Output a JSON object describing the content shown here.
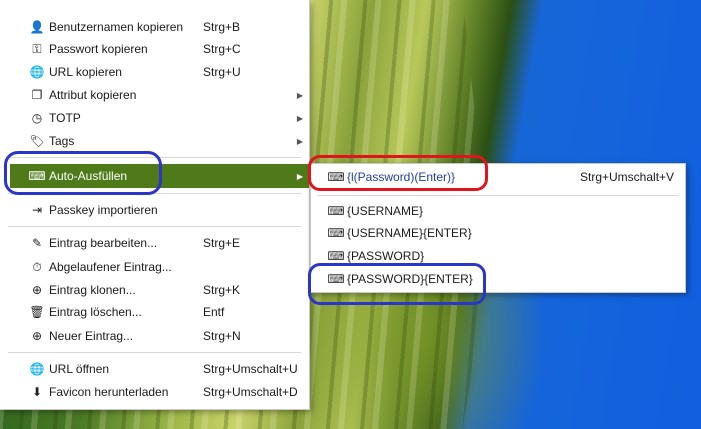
{
  "main_menu": {
    "items": [
      {
        "icon": "user-copy-icon",
        "glyph": "👤",
        "label": "Benutzernamen kopieren",
        "shortcut": "Strg+B"
      },
      {
        "icon": "key-icon",
        "glyph": "⚿",
        "label": "Passwort kopieren",
        "shortcut": "Strg+C"
      },
      {
        "icon": "globe-icon",
        "glyph": "🌐",
        "label": "URL kopieren",
        "shortcut": "Strg+U"
      },
      {
        "icon": "copy-icon",
        "glyph": "❐",
        "label": "Attribut kopieren",
        "submenu": true
      },
      {
        "icon": "clock-icon",
        "glyph": "◷",
        "label": "TOTP",
        "submenu": true
      },
      {
        "icon": "tag-icon",
        "glyph": "🏷",
        "label": "Tags",
        "submenu": true
      },
      {
        "icon": "keyboard-icon",
        "glyph": "⌨",
        "label": "Auto-Ausfüllen",
        "submenu": true,
        "active": true
      },
      {
        "icon": "import-icon",
        "glyph": "⇥",
        "label": "Passkey importieren"
      },
      {
        "icon": "edit-icon",
        "glyph": "✎",
        "label": "Eintrag bearbeiten...",
        "shortcut": "Strg+E"
      },
      {
        "icon": "timer-icon",
        "glyph": "⏱",
        "label": "Abgelaufener Eintrag..."
      },
      {
        "icon": "clone-icon",
        "glyph": "⊕",
        "label": "Eintrag klonen...",
        "shortcut": "Strg+K"
      },
      {
        "icon": "trash-icon",
        "glyph": "🗑",
        "label": "Eintrag löschen...",
        "shortcut": "Entf"
      },
      {
        "icon": "add-icon",
        "glyph": "⊕",
        "label": "Neuer Eintrag...",
        "shortcut": "Strg+N"
      },
      {
        "icon": "globe-open-icon",
        "glyph": "🌐",
        "label": "URL öffnen",
        "shortcut": "Strg+Umschalt+U"
      },
      {
        "icon": "download-icon",
        "glyph": "⬇",
        "label": "Favicon herunterladen",
        "shortcut": "Strg+Umschalt+D"
      }
    ],
    "submenu_arrow": "▶"
  },
  "sub_menu": {
    "items": [
      {
        "icon": "keyboard-icon",
        "glyph": "⌨",
        "label": "{l(Password)(Enter)}",
        "shortcut": "Strg+Umschalt+V"
      },
      {
        "icon": "keyboard-icon",
        "glyph": "⌨",
        "label": "{USERNAME}"
      },
      {
        "icon": "keyboard-icon",
        "glyph": "⌨",
        "label": "{USERNAME}{ENTER}"
      },
      {
        "icon": "keyboard-icon",
        "glyph": "⌨",
        "label": "{PASSWORD}"
      },
      {
        "icon": "keyboard-icon",
        "glyph": "⌨",
        "label": "{PASSWORD}{ENTER}"
      }
    ]
  },
  "colors": {
    "active_item": "#4f7a1a",
    "ring_blue": "#2b35c8",
    "ring_red": "#e0141c"
  }
}
